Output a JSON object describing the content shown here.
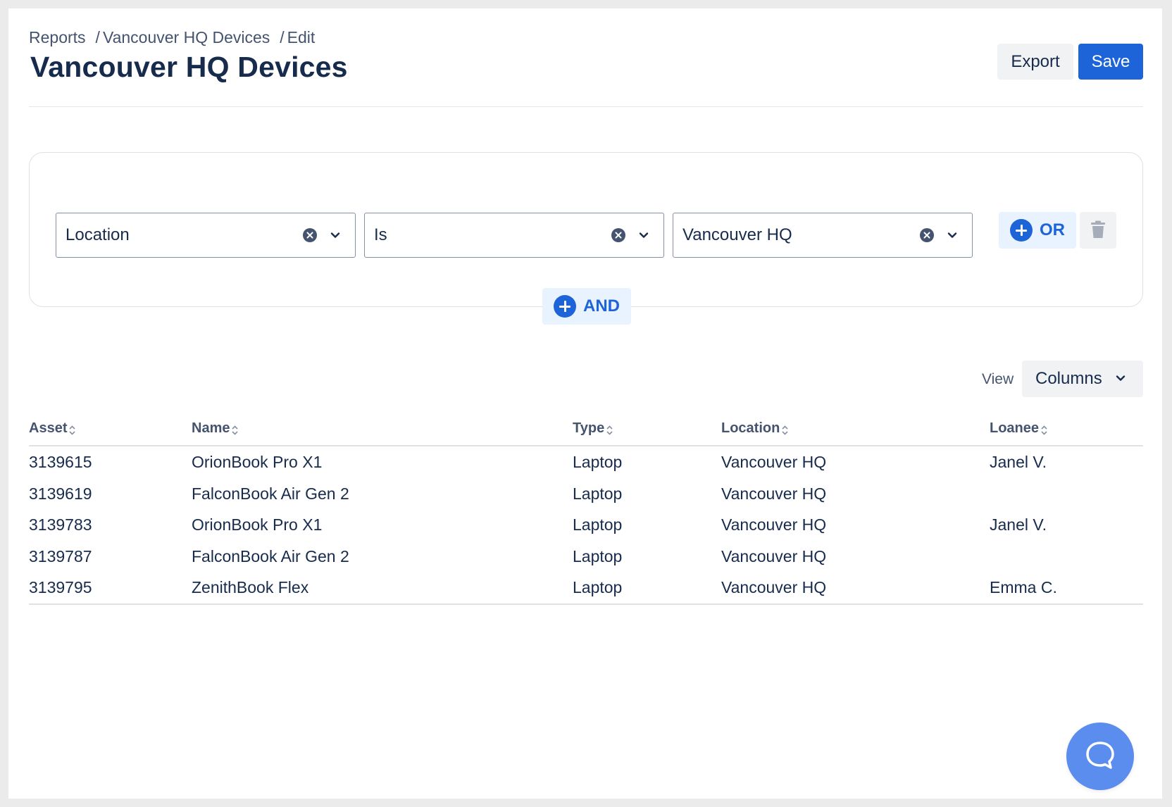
{
  "breadcrumb": {
    "items": [
      "Reports",
      "Vancouver HQ Devices",
      "Edit"
    ],
    "separator": "/"
  },
  "header": {
    "title": "Vancouver HQ Devices",
    "export_label": "Export",
    "save_label": "Save"
  },
  "filter": {
    "field": "Location",
    "operator": "Is",
    "value": "Vancouver HQ",
    "or_label": "OR",
    "and_label": "AND"
  },
  "view": {
    "label": "View",
    "columns_label": "Columns"
  },
  "table": {
    "columns": [
      "Asset",
      "Name",
      "Type",
      "Location",
      "Loanee"
    ],
    "rows": [
      [
        "3139615",
        "OrionBook Pro X1",
        "Laptop",
        "Vancouver HQ",
        "Janel V."
      ],
      [
        "3139619",
        "FalconBook Air Gen 2",
        "Laptop",
        "Vancouver HQ",
        ""
      ],
      [
        "3139783",
        "OrionBook Pro X1",
        "Laptop",
        "Vancouver HQ",
        "Janel V."
      ],
      [
        "3139787",
        "FalconBook Air Gen 2",
        "Laptop",
        "Vancouver HQ",
        ""
      ],
      [
        "3139795",
        "ZenithBook Flex",
        "Laptop",
        "Vancouver HQ",
        "Emma C."
      ]
    ]
  },
  "colors": {
    "primary": "#1d64d8",
    "help_bubble": "#5b8def",
    "text": "#172b4d",
    "subtle_text": "#44546f"
  },
  "icons": [
    "clear-icon",
    "chevron-down-icon",
    "plus-circle-icon",
    "trash-icon",
    "sort-icon",
    "chat-bubble-icon"
  ]
}
